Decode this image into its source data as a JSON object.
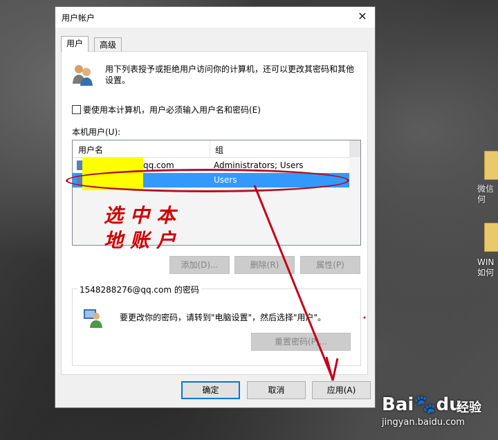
{
  "window": {
    "title": "用户帐户",
    "close_glyph": "✕"
  },
  "tabs": [
    {
      "label": "用户"
    },
    {
      "label": "高级"
    }
  ],
  "description": "用下列表授予或拒绝用户访问你的计算机，还可以更改其密码和其他设置。",
  "checkbox": {
    "label": "要使用本计算机，用户必须输入用户名和密码(E)",
    "checked": false
  },
  "local_users": {
    "label": "本机用户(U):",
    "columns": [
      "用户名",
      "组"
    ],
    "rows": [
      {
        "name": "qq.com",
        "group": "Administrators; Users",
        "selected": false
      },
      {
        "name": "",
        "group": "Users",
        "selected": true
      }
    ]
  },
  "annotation": {
    "line1": "选中本",
    "line2": "地账户",
    "color": "#d00000"
  },
  "user_buttons": {
    "add": "添加(D)...",
    "remove": "删除(R)",
    "properties": "属性(P)"
  },
  "password_group": {
    "title": "1548288276@qq.com 的密码",
    "text": "要更改你的密码，请转到\"电脑设置\"，然后选择\"用户\"。",
    "reset_button": "重置密码(P)..."
  },
  "footer": {
    "ok": "确定",
    "cancel": "取消",
    "apply": "应用(A)"
  },
  "desktop": {
    "icon1_label": "微信\n何",
    "icon2_label": "WIN\n如何"
  },
  "watermark": {
    "logo": "Bai",
    "logo2": "du",
    "text": "经验",
    "url": "jingyan.baidu.com"
  },
  "colors": {
    "selection": "#3399ff",
    "accent": "#0078d7",
    "annotation_red": "#d00000",
    "redaction": "#ffff00"
  }
}
